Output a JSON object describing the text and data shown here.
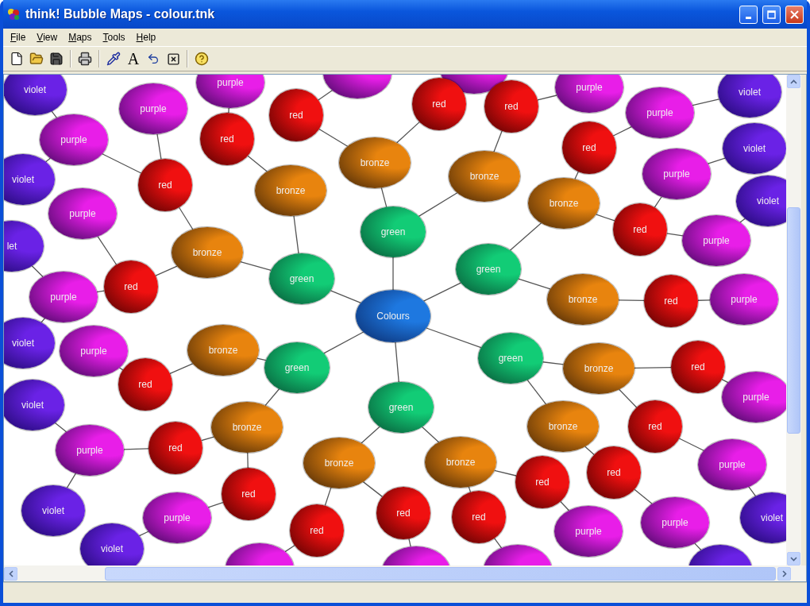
{
  "window": {
    "title": "think! Bubble Maps - colour.tnk"
  },
  "menu": [
    "File",
    "View",
    "Maps",
    "Tools",
    "Help"
  ],
  "toolbar": {
    "text_button": "A"
  },
  "map": {
    "nodes": [
      {
        "kind": "purple"
      },
      {
        "kind": "purple"
      },
      {
        "kind": "violet",
        "label": "violet"
      },
      {
        "kind": "purple",
        "label": "purple"
      },
      {
        "kind": "purple",
        "label": "purple"
      },
      {
        "kind": "violet",
        "label": "violet"
      },
      {
        "kind": "purple",
        "label": "purple"
      },
      {
        "kind": "red",
        "label": "red"
      },
      {
        "kind": "red",
        "label": "red"
      },
      {
        "kind": "red",
        "label": "red"
      },
      {
        "kind": "purple",
        "label": "purple"
      },
      {
        "kind": "purple",
        "label": "purple"
      },
      {
        "kind": "red",
        "label": "red"
      },
      {
        "kind": "red",
        "label": "red"
      },
      {
        "kind": "violet",
        "label": "violet"
      },
      {
        "kind": "bronze",
        "label": "bronze"
      },
      {
        "kind": "violet",
        "label": "violet"
      },
      {
        "kind": "red",
        "label": "red"
      },
      {
        "kind": "bronze",
        "label": "bronze"
      },
      {
        "kind": "bronze",
        "label": "bronze"
      },
      {
        "kind": "purple",
        "label": "purple"
      },
      {
        "kind": "bronze",
        "label": "bronze"
      },
      {
        "kind": "violet",
        "label": "violet"
      },
      {
        "kind": "purple",
        "label": "purple"
      },
      {
        "kind": "green",
        "label": "green"
      },
      {
        "kind": "red",
        "label": "red"
      },
      {
        "kind": "violet",
        "label": "let"
      },
      {
        "kind": "bronze",
        "label": "bronze"
      },
      {
        "kind": "purple",
        "label": "purple"
      },
      {
        "kind": "green",
        "label": "green"
      },
      {
        "kind": "red",
        "label": "red"
      },
      {
        "kind": "green",
        "label": "green"
      },
      {
        "kind": "purple",
        "label": "purple"
      },
      {
        "kind": "bronze",
        "label": "bronze"
      },
      {
        "kind": "red",
        "label": "red"
      },
      {
        "kind": "purple",
        "label": "purple"
      },
      {
        "kind": "center",
        "label": "Colours"
      },
      {
        "kind": "violet",
        "label": "violet"
      },
      {
        "kind": "purple",
        "label": "purple"
      },
      {
        "kind": "bronze",
        "label": "bronze"
      },
      {
        "kind": "green",
        "label": "green"
      },
      {
        "kind": "green",
        "label": "green"
      },
      {
        "kind": "bronze",
        "label": "bronze"
      },
      {
        "kind": "red",
        "label": "red"
      },
      {
        "kind": "red",
        "label": "red"
      },
      {
        "kind": "purple",
        "label": "purple"
      },
      {
        "kind": "violet",
        "label": "violet"
      },
      {
        "kind": "green",
        "label": "green"
      },
      {
        "kind": "bronze",
        "label": "bronze"
      },
      {
        "kind": "bronze",
        "label": "bronze"
      },
      {
        "kind": "red",
        "label": "red"
      },
      {
        "kind": "purple",
        "label": "purple"
      },
      {
        "kind": "red",
        "label": "red"
      },
      {
        "kind": "bronze",
        "label": "bronze"
      },
      {
        "kind": "bronze",
        "label": "bronze"
      },
      {
        "kind": "red",
        "label": "red"
      },
      {
        "kind": "purple",
        "label": "purple"
      },
      {
        "kind": "red",
        "label": "red"
      },
      {
        "kind": "red",
        "label": "red"
      },
      {
        "kind": "violet",
        "label": "violet"
      },
      {
        "kind": "purple",
        "label": "purple"
      },
      {
        "kind": "red",
        "label": "red"
      },
      {
        "kind": "red",
        "label": "red"
      },
      {
        "kind": "red",
        "label": "red"
      },
      {
        "kind": "purple",
        "label": "purple"
      },
      {
        "kind": "purple",
        "label": "purple"
      },
      {
        "kind": "violet",
        "label": "violet"
      },
      {
        "kind": "violet",
        "label": "violet"
      },
      {
        "kind": "purple"
      },
      {
        "kind": "purple"
      },
      {
        "kind": "purple"
      },
      {
        "kind": "violet"
      }
    ]
  }
}
